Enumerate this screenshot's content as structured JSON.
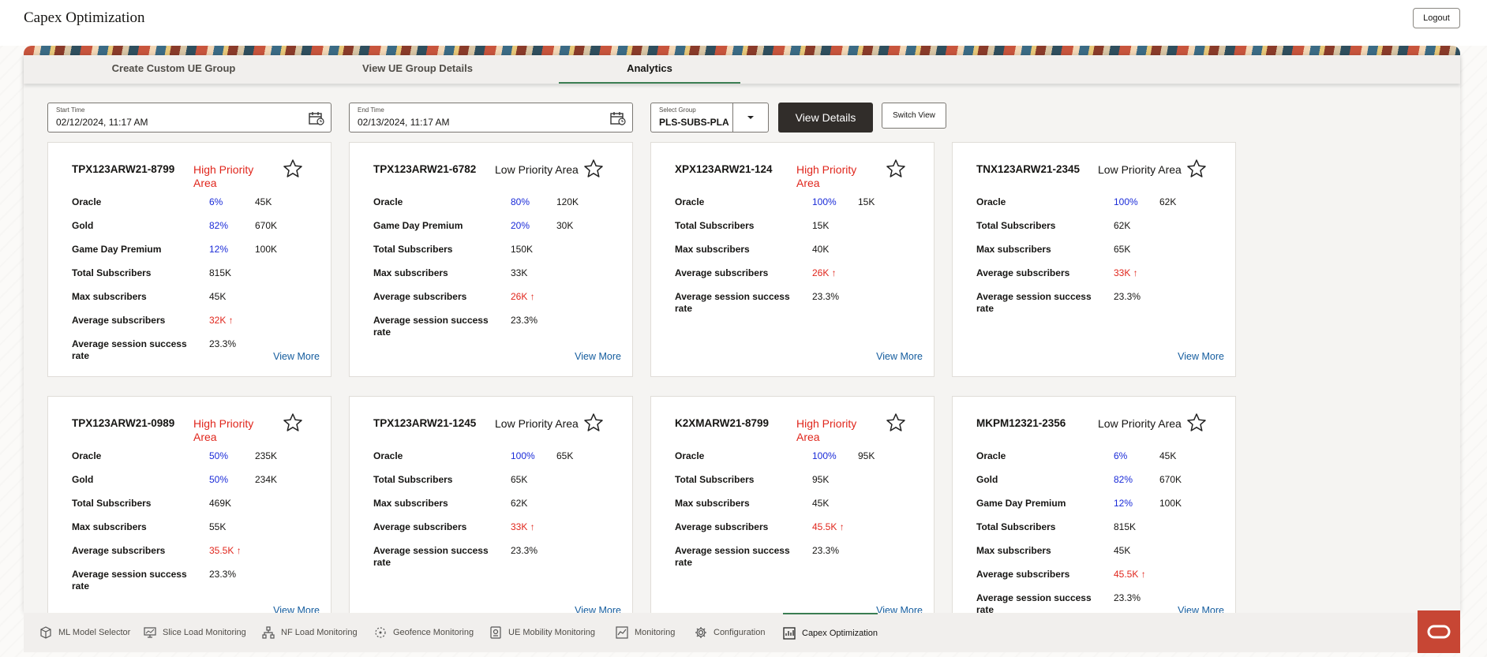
{
  "app": {
    "title": "Capex Optimization",
    "logout_label": "Logout"
  },
  "tabs": [
    {
      "label": "Create Custom UE Group"
    },
    {
      "label": "View UE Group Details"
    },
    {
      "label": "Analytics",
      "active": true
    }
  ],
  "filters": {
    "start_label": "Start Time",
    "start_value": "02/12/2024, 11:17 AM",
    "end_label": "End Time",
    "end_value": "02/13/2024, 11:17 AM",
    "group_label": "Select Group",
    "group_value": "PLS-SUBS-PLA",
    "view_details_label": "View Details",
    "switch_view_label": "Switch View"
  },
  "colors": {
    "accent": "#3a7d52",
    "high_priority": "#e0261c",
    "percent": "#1a2bd8",
    "dark_button": "#312d2a",
    "link": "#145c9e",
    "brand": "#c74634"
  },
  "cards": [
    {
      "id": "TPX123ARW21-8799",
      "priority": "High Priority Area",
      "priority_level": "high",
      "rows": [
        {
          "k": "Oracle",
          "v1": "6%",
          "v2": "45K",
          "t": "pct"
        },
        {
          "k": "Gold",
          "v1": "82%",
          "v2": "670K",
          "t": "pct"
        },
        {
          "k": "Game Day Premium",
          "v1": "12%",
          "v2": "100K",
          "t": "pct"
        },
        {
          "k": "Total Subscribers",
          "v1": "815K",
          "v2": ""
        },
        {
          "k": "Max subscribers",
          "v1": "45K",
          "v2": ""
        },
        {
          "k": "Average subscribers",
          "v1": "32K ↑",
          "v2": "",
          "t": "up"
        },
        {
          "k": "Average session success rate",
          "v1": "23.3%",
          "v2": ""
        }
      ],
      "view_more": "View More"
    },
    {
      "id": "TPX123ARW21-6782",
      "priority": "Low Priority Area",
      "priority_level": "low",
      "rows": [
        {
          "k": "Oracle",
          "v1": "80%",
          "v2": "120K",
          "t": "pct"
        },
        {
          "k": "Game Day Premium",
          "v1": "20%",
          "v2": "30K",
          "t": "pct"
        },
        {
          "k": "Total Subscribers",
          "v1": "150K",
          "v2": ""
        },
        {
          "k": "Max subscribers",
          "v1": "33K",
          "v2": ""
        },
        {
          "k": "Average subscribers",
          "v1": "26K ↑",
          "v2": "",
          "t": "up"
        },
        {
          "k": "Average session success rate",
          "v1": "23.3%",
          "v2": ""
        }
      ],
      "view_more": "View More"
    },
    {
      "id": "XPX123ARW21-124",
      "priority": "High Priority Area",
      "priority_level": "high",
      "rows": [
        {
          "k": "Oracle",
          "v1": "100%",
          "v2": "15K",
          "t": "pct"
        },
        {
          "k": "Total Subscribers",
          "v1": "15K",
          "v2": ""
        },
        {
          "k": "Max subscribers",
          "v1": "40K",
          "v2": ""
        },
        {
          "k": "Average subscribers",
          "v1": "26K ↑",
          "v2": "",
          "t": "up"
        },
        {
          "k": "Average session success rate",
          "v1": "23.3%",
          "v2": ""
        }
      ],
      "view_more": "View More"
    },
    {
      "id": "TNX123ARW21-2345",
      "priority": "Low Priority Area",
      "priority_level": "low",
      "rows": [
        {
          "k": "Oracle",
          "v1": "100%",
          "v2": "62K",
          "t": "pct"
        },
        {
          "k": "Total Subscribers",
          "v1": "62K",
          "v2": ""
        },
        {
          "k": "Max subscribers",
          "v1": "65K",
          "v2": ""
        },
        {
          "k": "Average subscribers",
          "v1": "33K ↑",
          "v2": "",
          "t": "up"
        },
        {
          "k": "Average session success rate",
          "v1": "23.3%",
          "v2": ""
        }
      ],
      "view_more": "View More"
    },
    {
      "id": "TPX123ARW21-0989",
      "priority": "High Priority Area",
      "priority_level": "high",
      "rows": [
        {
          "k": "Oracle",
          "v1": "50%",
          "v2": "235K",
          "t": "pct"
        },
        {
          "k": "Gold",
          "v1": "50%",
          "v2": "234K",
          "t": "pct"
        },
        {
          "k": "Total Subscribers",
          "v1": "469K",
          "v2": ""
        },
        {
          "k": "Max subscribers",
          "v1": "55K",
          "v2": ""
        },
        {
          "k": "Average subscribers",
          "v1": "35.5K ↑",
          "v2": "",
          "t": "up"
        },
        {
          "k": "Average session success rate",
          "v1": "23.3%",
          "v2": ""
        }
      ],
      "view_more": "View More"
    },
    {
      "id": "TPX123ARW21-1245",
      "priority": "Low Priority Area",
      "priority_level": "low",
      "rows": [
        {
          "k": "Oracle",
          "v1": "100%",
          "v2": "65K",
          "t": "pct"
        },
        {
          "k": "Total Subscribers",
          "v1": "65K",
          "v2": ""
        },
        {
          "k": "Max subscribers",
          "v1": "62K",
          "v2": ""
        },
        {
          "k": "Average subscribers",
          "v1": "33K ↑",
          "v2": "",
          "t": "up"
        },
        {
          "k": "Average session success rate",
          "v1": "23.3%",
          "v2": ""
        }
      ],
      "view_more": "View More"
    },
    {
      "id": "K2XMARW21-8799",
      "priority": "High Priority Area",
      "priority_level": "high",
      "rows": [
        {
          "k": "Oracle",
          "v1": "100%",
          "v2": "95K",
          "t": "pct"
        },
        {
          "k": "Total Subscribers",
          "v1": "95K",
          "v2": ""
        },
        {
          "k": "Max subscribers",
          "v1": "45K",
          "v2": ""
        },
        {
          "k": "Average subscribers",
          "v1": "45.5K ↑",
          "v2": "",
          "t": "up"
        },
        {
          "k": "Average session success rate",
          "v1": "23.3%",
          "v2": ""
        }
      ],
      "view_more": "View More"
    },
    {
      "id": "MKPM12321-2356",
      "priority": "Low Priority Area",
      "priority_level": "low",
      "rows": [
        {
          "k": "Oracle",
          "v1": "6%",
          "v2": "45K",
          "t": "pct"
        },
        {
          "k": "Gold",
          "v1": "82%",
          "v2": "670K",
          "t": "pct"
        },
        {
          "k": "Game Day Premium",
          "v1": "12%",
          "v2": "100K",
          "t": "pct"
        },
        {
          "k": "Total Subscribers",
          "v1": "815K",
          "v2": ""
        },
        {
          "k": "Max subscribers",
          "v1": "45K",
          "v2": ""
        },
        {
          "k": "Average subscribers",
          "v1": "45.5K ↑",
          "v2": "",
          "t": "up"
        },
        {
          "k": "Average session success rate",
          "v1": "23.3%",
          "v2": ""
        }
      ],
      "view_more": "View More"
    }
  ],
  "bottom_nav": [
    {
      "label": "ML Model Selector",
      "icon": "cube-icon"
    },
    {
      "label": "Slice Load Monitoring",
      "icon": "monitor-icon"
    },
    {
      "label": "NF Load Monitoring",
      "icon": "network-icon"
    },
    {
      "label": "Geofence Monitoring",
      "icon": "geofence-icon"
    },
    {
      "label": "UE Mobility Monitoring",
      "icon": "device-icon"
    },
    {
      "label": "Monitoring",
      "icon": "chart-icon"
    },
    {
      "label": "Configuration",
      "icon": "gear-icon"
    },
    {
      "label": "Capex Optimization",
      "icon": "capex-icon",
      "active": true
    }
  ]
}
